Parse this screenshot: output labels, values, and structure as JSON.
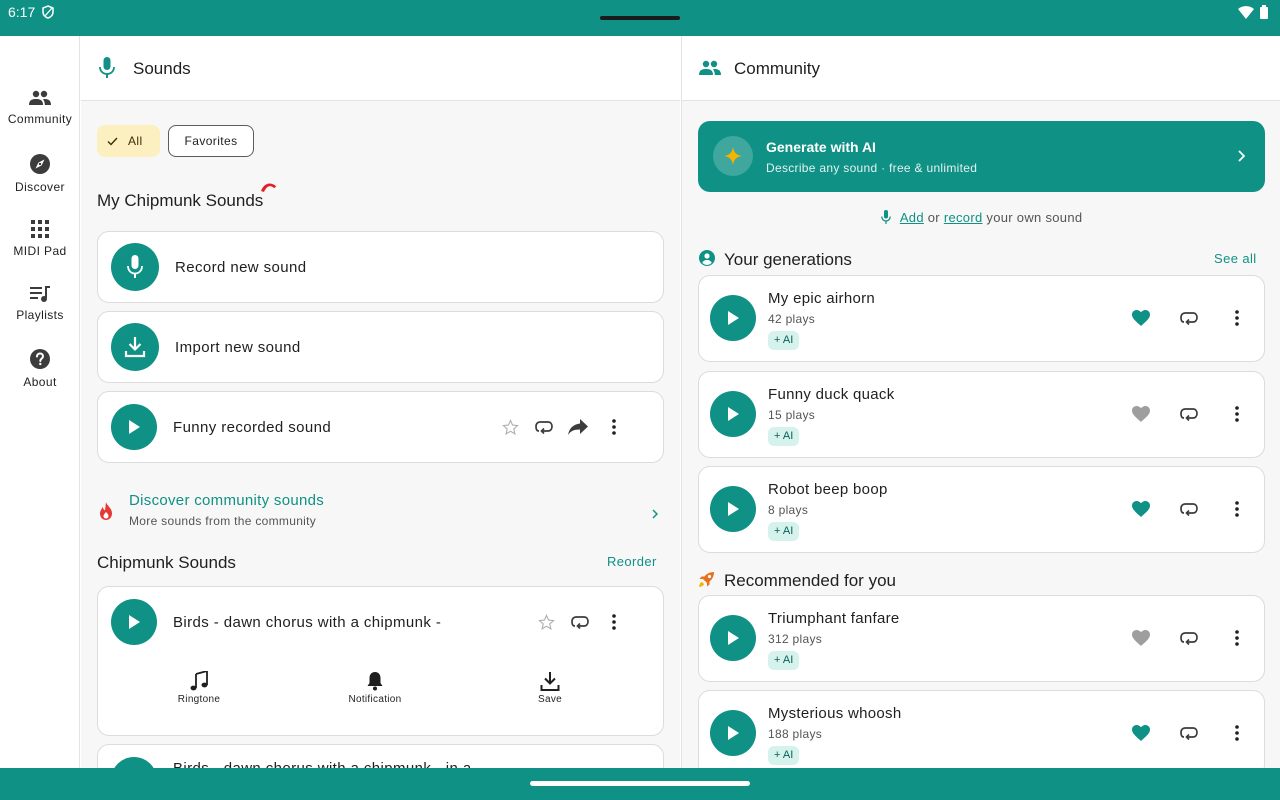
{
  "status": {
    "time": "6:17"
  },
  "rail": [
    {
      "label": "Community",
      "icon": "people-icon"
    },
    {
      "label": "Discover",
      "icon": "compass-icon"
    },
    {
      "label": "MIDI Pad",
      "icon": "grid-icon"
    },
    {
      "label": "Playlists",
      "icon": "playlist-icon"
    },
    {
      "label": "About",
      "icon": "help-icon"
    }
  ],
  "sounds": {
    "title": "Sounds",
    "chips": {
      "all": "All",
      "favorites": "Favorites"
    },
    "my_section_title": "My Chipmunk Sounds",
    "record_label": "Record new sound",
    "import_label": "Import new sound",
    "recorded_label": "Funny recorded sound",
    "discover": {
      "title": "Discover community sounds",
      "subtitle": "More sounds from the community"
    },
    "chipmunk_section_title": "Chipmunk Sounds",
    "reorder": "Reorder",
    "items": [
      {
        "title": "Birds - dawn chorus with a chipmunk -"
      },
      {
        "title": "Birds - dawn chorus with a chipmunk - in a"
      }
    ],
    "quick_actions": {
      "ringtone": "Ringtone",
      "notification": "Notification",
      "save": "Save"
    }
  },
  "community": {
    "title": "Community",
    "ai_banner": {
      "title": "Generate with AI",
      "subtitle": "Describe any sound · free & unlimited"
    },
    "add_line": {
      "add": "Add",
      "or": " or ",
      "record": "record",
      "rest": " your own sound"
    },
    "generations_title": "Your generations",
    "see_all": "See all",
    "recommended_title": "Recommended for you",
    "generations": [
      {
        "title": "My epic airhorn",
        "plays": "42 plays",
        "badge": "+ AI",
        "favorite": true
      },
      {
        "title": "Funny duck quack",
        "plays": "15 plays",
        "badge": "+ AI",
        "favorite": false
      },
      {
        "title": "Robot beep boop",
        "plays": "8 plays",
        "badge": "+ AI",
        "favorite": true
      }
    ],
    "recommended": [
      {
        "title": "Triumphant fanfare",
        "plays": "312 plays",
        "badge": "+ AI",
        "favorite": false
      },
      {
        "title": "Mysterious whoosh",
        "plays": "188 plays",
        "badge": "+ AI",
        "favorite": true
      }
    ]
  },
  "colors": {
    "accent": "#0f9185",
    "chip_selected": "#fcefc0",
    "heart_off": "#9e9e9e",
    "fire": "#e53935"
  }
}
